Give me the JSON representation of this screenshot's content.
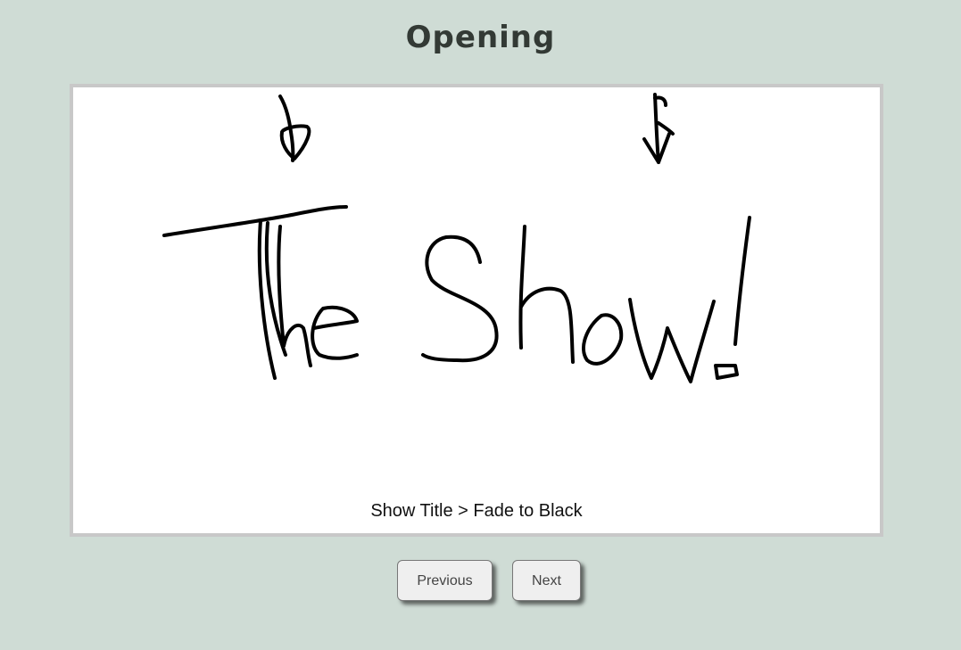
{
  "page": {
    "title": "Opening"
  },
  "slide": {
    "caption": "Show Title > Fade to Black",
    "drawing_subject": "hand-drawn text 'The Show!' with two down-arrows"
  },
  "nav": {
    "previous_label": "Previous",
    "next_label": "Next"
  },
  "colors": {
    "background": "#cfdcd5",
    "title": "#333a35",
    "frame_border": "#c8c8c8",
    "button_bg": "#efefef"
  }
}
